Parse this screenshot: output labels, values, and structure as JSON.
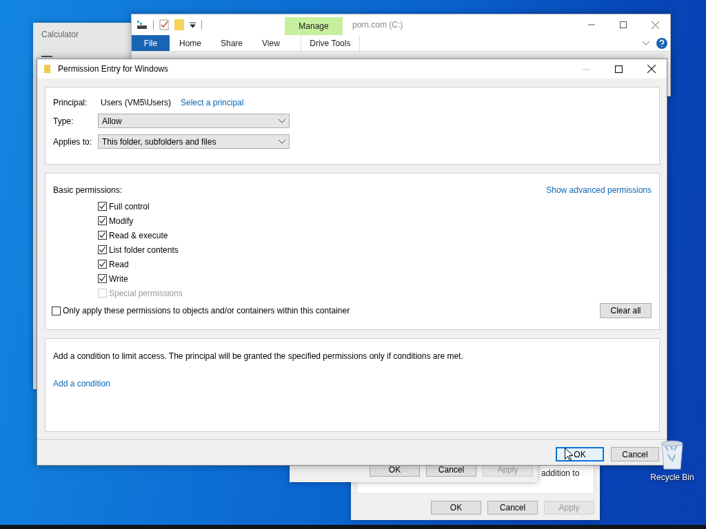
{
  "desktop": {
    "icons": [
      {
        "label": "Recycle Bin"
      }
    ]
  },
  "calculator": {
    "title": "Calculator"
  },
  "explorer": {
    "title": "porn.com (C:)",
    "context_group": "Manage",
    "tabs": [
      {
        "label": "File",
        "kind": "file"
      },
      {
        "label": "Home",
        "kind": "tab"
      },
      {
        "label": "Share",
        "kind": "tab"
      },
      {
        "label": "View",
        "kind": "tab"
      },
      {
        "label": "Drive Tools",
        "kind": "contextual"
      }
    ]
  },
  "back_dialogs": [
    {
      "text": "addition to",
      "buttons": [
        {
          "label": "OK",
          "disabled": false
        },
        {
          "label": "Cancel",
          "disabled": false
        },
        {
          "label": "Apply",
          "disabled": true
        }
      ]
    },
    {
      "buttons": [
        {
          "label": "OK",
          "disabled": false
        },
        {
          "label": "Cancel",
          "disabled": false
        },
        {
          "label": "Apply",
          "disabled": true
        }
      ]
    }
  ],
  "dialog": {
    "title": "Permission Entry for Windows",
    "principal_label": "Principal:",
    "principal": "Users (VM5\\Users)",
    "select_link": "Select a principal",
    "fields": [
      {
        "label": "Type:",
        "value": "Allow"
      },
      {
        "label": "Applies to:",
        "value": "This folder, subfolders and files"
      }
    ],
    "basic_label": "Basic permissions:",
    "advanced_link": "Show advanced permissions",
    "permissions": [
      {
        "label": "Full control",
        "checked": true,
        "disabled": false
      },
      {
        "label": "Modify",
        "checked": true,
        "disabled": false
      },
      {
        "label": "Read & execute",
        "checked": true,
        "disabled": false
      },
      {
        "label": "List folder contents",
        "checked": true,
        "disabled": false
      },
      {
        "label": "Read",
        "checked": true,
        "disabled": false
      },
      {
        "label": "Write",
        "checked": true,
        "disabled": false
      },
      {
        "label": "Special permissions",
        "checked": false,
        "disabled": true
      }
    ],
    "only_apply": {
      "label": "Only apply these permissions to objects and/or containers within this container",
      "checked": false
    },
    "clear_button": "Clear all",
    "condition_text": "Add a condition to limit access. The principal will be granted the specified permissions only if conditions are met.",
    "condition_link": "Add a condition",
    "buttons": [
      {
        "label": "OK",
        "focused": true
      },
      {
        "label": "Cancel",
        "focused": false
      }
    ]
  }
}
